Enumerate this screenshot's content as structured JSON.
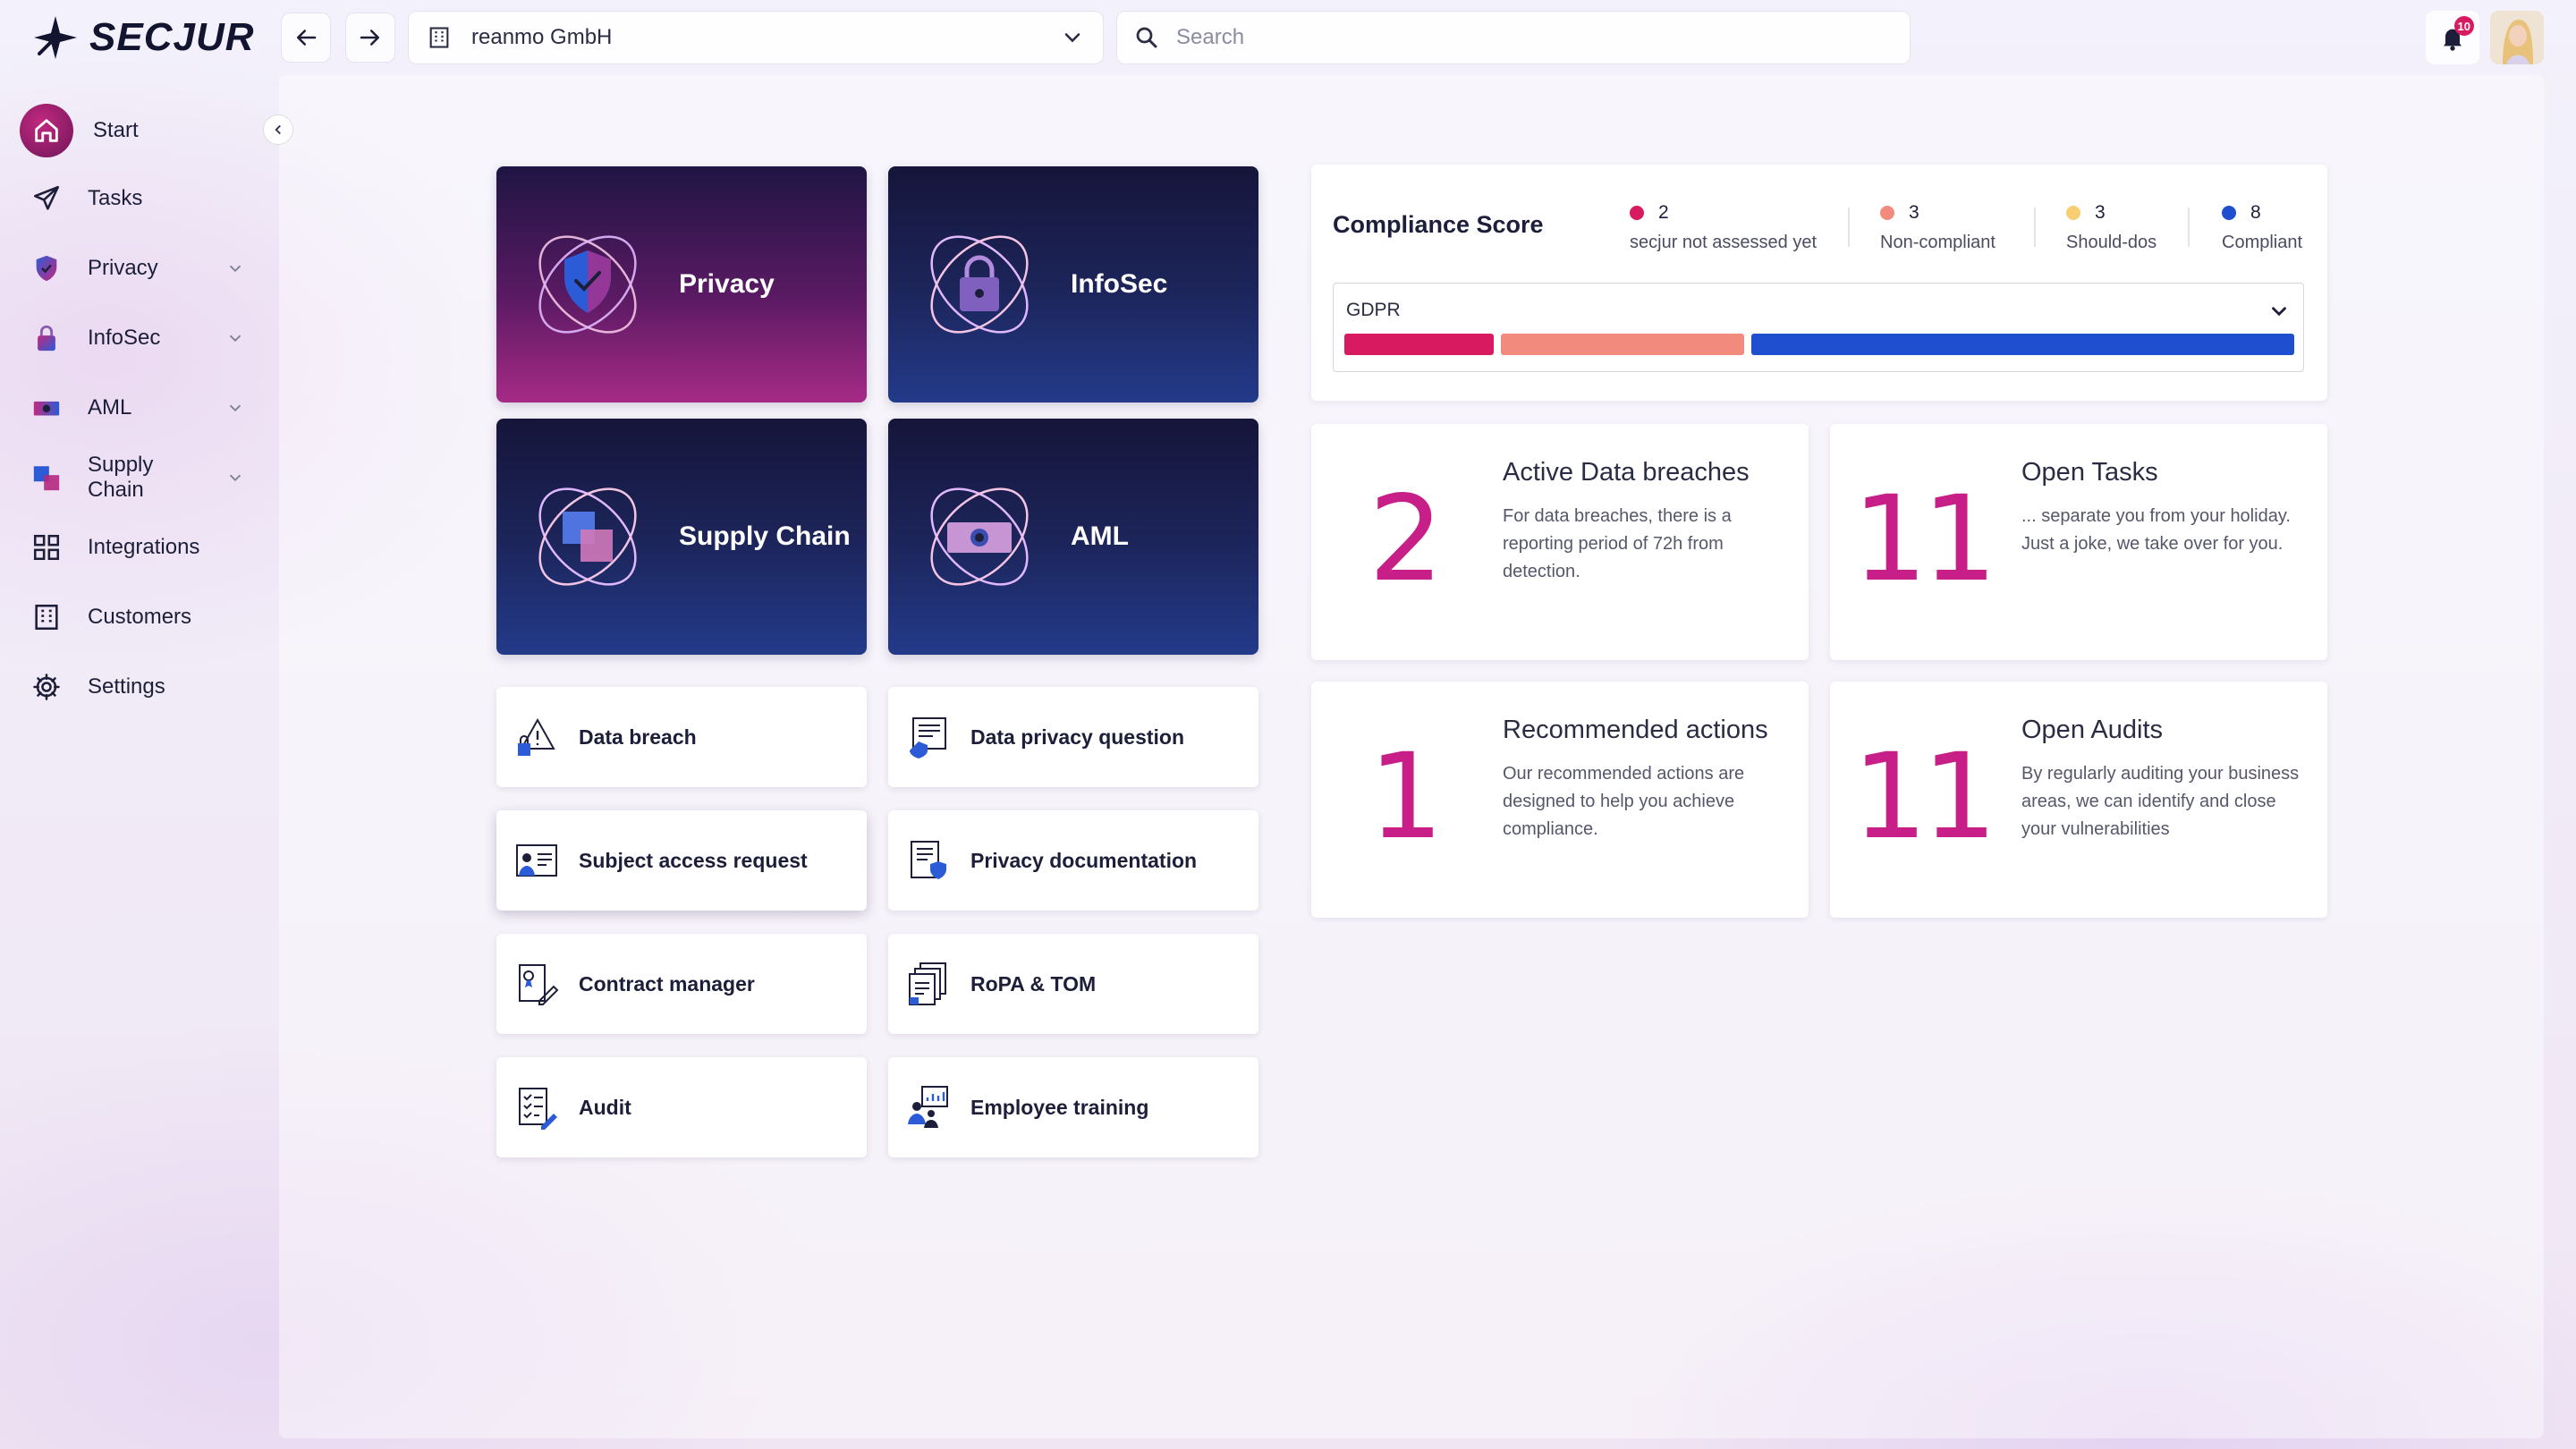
{
  "app": {
    "logo_text": "SECJUR"
  },
  "topbar": {
    "company": "reanmo GmbH",
    "search_placeholder": "Search",
    "notification_count": "10"
  },
  "sidebar": {
    "items": [
      {
        "label": "Start",
        "icon": "home-icon",
        "active": true
      },
      {
        "label": "Tasks",
        "icon": "paper-plane-icon"
      },
      {
        "label": "Privacy",
        "icon": "shield-icon",
        "expandable": true
      },
      {
        "label": "InfoSec",
        "icon": "lock-icon",
        "expandable": true
      },
      {
        "label": "AML",
        "icon": "camera-icon",
        "expandable": true
      },
      {
        "label": "Supply Chain",
        "icon": "cubes-icon",
        "expandable": true
      },
      {
        "label": "Integrations",
        "icon": "grid-icon"
      },
      {
        "label": "Customers",
        "icon": "building-icon"
      },
      {
        "label": "Settings",
        "icon": "gear-icon"
      }
    ]
  },
  "modules": [
    {
      "label": "Privacy",
      "icon": "shield-check-icon"
    },
    {
      "label": "InfoSec",
      "icon": "padlock-icon"
    },
    {
      "label": "Supply Chain",
      "icon": "cubes-icon"
    },
    {
      "label": "AML",
      "icon": "cash-icon"
    }
  ],
  "tools": [
    {
      "label": "Data breach",
      "icon": "breach-icon"
    },
    {
      "label": "Data privacy question",
      "icon": "question-doc-icon"
    },
    {
      "label": "Subject access request",
      "icon": "id-card-icon"
    },
    {
      "label": "Privacy documentation",
      "icon": "shield-doc-icon"
    },
    {
      "label": "Contract manager",
      "icon": "contract-icon"
    },
    {
      "label": "RoPA & TOM",
      "icon": "docs-stack-icon"
    },
    {
      "label": "Audit",
      "icon": "audit-checklist-icon"
    },
    {
      "label": "Employee training",
      "icon": "training-icon"
    }
  ],
  "compliance": {
    "title": "Compliance Score",
    "stats": [
      {
        "value": "2",
        "label": "secjur not assessed yet",
        "color": "#d81b60"
      },
      {
        "value": "3",
        "label": "Non-compliant",
        "color": "#f28b7d"
      },
      {
        "value": "3",
        "label": "Should-dos",
        "color": "#f7cf72"
      },
      {
        "value": "8",
        "label": "Compliant",
        "color": "#1f4fcf"
      }
    ],
    "framework": "GDPR",
    "bar_segments": [
      {
        "name": "not-assessed",
        "fraction": 0.16,
        "color": "#d81b60"
      },
      {
        "name": "non-compliant",
        "fraction": 0.26,
        "color": "#f28b7d"
      },
      {
        "name": "compliant",
        "fraction": 0.58,
        "color": "#1f4fcf"
      }
    ]
  },
  "kpis": [
    {
      "number": "2",
      "title": "Active Data breaches",
      "desc": "For data breaches, there is a reporting period of 72h from detection."
    },
    {
      "number": "11",
      "title": "Open Tasks",
      "desc": "... separate you from your holiday. Just a joke, we take over for you."
    },
    {
      "number": "1",
      "title": "Recommended actions",
      "desc": "Our recommended actions are designed to help you achieve compliance."
    },
    {
      "number": "11",
      "title": "Open Audits",
      "desc": "By regularly auditing your business areas, we can identify and close your vulnerabilities"
    }
  ]
}
